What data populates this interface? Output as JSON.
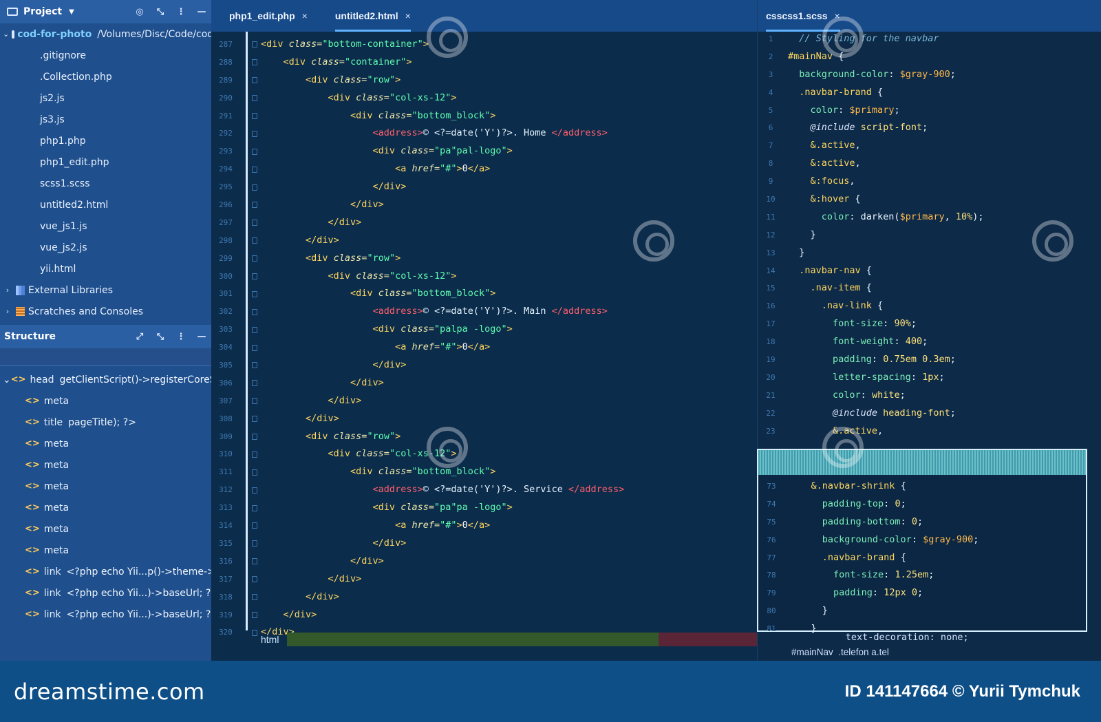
{
  "project_panel": {
    "title": "Project",
    "root_name": "cod-for-photo",
    "root_path": "/Volumes/Disc/Code/cod",
    "files": [
      ".gitignore",
      ".Collection.php",
      "js2.js",
      "js3.js",
      "php1.php",
      "php1_edit.php",
      "scss1.scss",
      "untitled2.html",
      "vue_js1.js",
      "vue_js2.js",
      "yii.html"
    ],
    "groups": [
      "External Libraries",
      "Scratches and Consoles"
    ]
  },
  "structure_panel": {
    "title": "Structure",
    "items": [
      {
        "tag": "head",
        "detail": "getClientScript()->registerCoreScrip",
        "level": 0
      },
      {
        "tag": "meta",
        "detail": "",
        "level": 1
      },
      {
        "tag": "title",
        "detail": "pageTitle); ?>",
        "level": 1
      },
      {
        "tag": "meta",
        "detail": "",
        "level": 1
      },
      {
        "tag": "meta",
        "detail": "",
        "level": 1
      },
      {
        "tag": "meta",
        "detail": "",
        "level": 1
      },
      {
        "tag": "meta",
        "detail": "",
        "level": 1
      },
      {
        "tag": "meta",
        "detail": "",
        "level": 1
      },
      {
        "tag": "meta",
        "detail": "",
        "level": 1
      },
      {
        "tag": "link",
        "detail": "<?php echo Yii...p()->theme->ba",
        "level": 1
      },
      {
        "tag": "link",
        "detail": "<?php echo Yii...)->baseUrl; ?>/c",
        "level": 1
      },
      {
        "tag": "link",
        "detail": "<?php echo Yii...)->baseUrl; ?>/c",
        "level": 1
      }
    ]
  },
  "editor_tabs": [
    {
      "label": "php1_edit.php",
      "active": false
    },
    {
      "label": "untitled2.html",
      "active": true
    }
  ],
  "right_tabs": [
    {
      "label": "csscss1.scss",
      "active": true
    }
  ],
  "editor": {
    "line_numbers": [
      "287",
      "288",
      "289",
      "290",
      "291",
      "292",
      "293",
      "294",
      "295",
      "296",
      "297",
      "298",
      "299",
      "300",
      "301",
      "302",
      "303",
      "304",
      "305",
      "306",
      "307",
      "308",
      "309",
      "310",
      "311",
      "312",
      "313",
      "314",
      "315",
      "316",
      "317",
      "318",
      "319",
      "320"
    ],
    "lines": [
      [
        {
          "t": "<div ",
          "c": "tag"
        },
        {
          "t": "class=",
          "c": "attr"
        },
        {
          "t": "\"bottom-container\"",
          "c": "str"
        },
        {
          "t": ">",
          "c": "tag"
        }
      ],
      [
        {
          "t": "    <div ",
          "c": "tag"
        },
        {
          "t": "class=",
          "c": "attr"
        },
        {
          "t": "\"container\"",
          "c": "str"
        },
        {
          "t": ">",
          "c": "tag"
        }
      ],
      [
        {
          "t": "        <div ",
          "c": "tag"
        },
        {
          "t": "class=",
          "c": "attr"
        },
        {
          "t": "\"row\"",
          "c": "str"
        },
        {
          "t": ">",
          "c": "tag"
        }
      ],
      [
        {
          "t": "            <div ",
          "c": "tag"
        },
        {
          "t": "class=",
          "c": "attr"
        },
        {
          "t": "\"col-xs-12\"",
          "c": "str"
        },
        {
          "t": ">",
          "c": "tag"
        }
      ],
      [
        {
          "t": "                <div ",
          "c": "tag"
        },
        {
          "t": "class=",
          "c": "attr"
        },
        {
          "t": "\"bottom_block\"",
          "c": "str"
        },
        {
          "t": ">",
          "c": "tag"
        }
      ],
      [
        {
          "t": "                    <address>",
          "c": "red"
        },
        {
          "t": "© <?=date('Y')?>. Home ",
          "c": "php"
        },
        {
          "t": "</address>",
          "c": "red"
        }
      ],
      [
        {
          "t": "                    <div ",
          "c": "tag"
        },
        {
          "t": "class=",
          "c": "attr"
        },
        {
          "t": "\"pa\"pal-logo\"",
          "c": "str"
        },
        {
          "t": ">",
          "c": "tag"
        }
      ],
      [
        {
          "t": "                        <a ",
          "c": "tag"
        },
        {
          "t": "href=",
          "c": "attr"
        },
        {
          "t": "\"#\"",
          "c": "str"
        },
        {
          "t": ">",
          "c": "tag"
        },
        {
          "t": "0",
          "c": "txt"
        },
        {
          "t": "</a>",
          "c": "tag"
        }
      ],
      [
        {
          "t": "                    </div>",
          "c": "tag"
        }
      ],
      [
        {
          "t": "                </div>",
          "c": "tag"
        }
      ],
      [
        {
          "t": "            </div>",
          "c": "tag"
        }
      ],
      [
        {
          "t": "        </div>",
          "c": "tag"
        }
      ],
      [
        {
          "t": "        <div ",
          "c": "tag"
        },
        {
          "t": "class=",
          "c": "attr"
        },
        {
          "t": "\"row\"",
          "c": "str"
        },
        {
          "t": ">",
          "c": "tag"
        }
      ],
      [
        {
          "t": "            <div ",
          "c": "tag"
        },
        {
          "t": "class=",
          "c": "attr"
        },
        {
          "t": "\"col-xs-12\"",
          "c": "str"
        },
        {
          "t": ">",
          "c": "tag"
        }
      ],
      [
        {
          "t": "                <div ",
          "c": "tag"
        },
        {
          "t": "class=",
          "c": "attr"
        },
        {
          "t": "\"bottom_block\"",
          "c": "str"
        },
        {
          "t": ">",
          "c": "tag"
        }
      ],
      [
        {
          "t": "                    <address>",
          "c": "red"
        },
        {
          "t": "© <?=date('Y')?>. Main ",
          "c": "php"
        },
        {
          "t": "</address>",
          "c": "red"
        }
      ],
      [
        {
          "t": "                    <div ",
          "c": "tag"
        },
        {
          "t": "class=",
          "c": "attr"
        },
        {
          "t": "\"palpa -logo\"",
          "c": "str"
        },
        {
          "t": ">",
          "c": "tag"
        }
      ],
      [
        {
          "t": "                        <a ",
          "c": "tag"
        },
        {
          "t": "href=",
          "c": "attr"
        },
        {
          "t": "\"#\"",
          "c": "str"
        },
        {
          "t": ">",
          "c": "tag"
        },
        {
          "t": "0",
          "c": "txt"
        },
        {
          "t": "</a>",
          "c": "tag"
        }
      ],
      [
        {
          "t": "                    </div>",
          "c": "tag"
        }
      ],
      [
        {
          "t": "                </div>",
          "c": "tag"
        }
      ],
      [
        {
          "t": "            </div>",
          "c": "tag"
        }
      ],
      [
        {
          "t": "        </div>",
          "c": "tag"
        }
      ],
      [
        {
          "t": "        <div ",
          "c": "tag"
        },
        {
          "t": "class=",
          "c": "attr"
        },
        {
          "t": "\"row\"",
          "c": "str"
        },
        {
          "t": ">",
          "c": "tag"
        }
      ],
      [
        {
          "t": "            <div ",
          "c": "tag"
        },
        {
          "t": "class=",
          "c": "attr"
        },
        {
          "t": "\"col-xs-12\"",
          "c": "str"
        },
        {
          "t": ">",
          "c": "tag"
        }
      ],
      [
        {
          "t": "                <div ",
          "c": "tag"
        },
        {
          "t": "class=",
          "c": "attr"
        },
        {
          "t": "\"bottom_block\"",
          "c": "str"
        },
        {
          "t": ">",
          "c": "tag"
        }
      ],
      [
        {
          "t": "                    <address>",
          "c": "red"
        },
        {
          "t": "© <?=date('Y')?>. Service ",
          "c": "php"
        },
        {
          "t": "</address>",
          "c": "red"
        }
      ],
      [
        {
          "t": "                    <div ",
          "c": "tag"
        },
        {
          "t": "class=",
          "c": "attr"
        },
        {
          "t": "\"pa\"pa -logo\"",
          "c": "str"
        },
        {
          "t": ">",
          "c": "tag"
        }
      ],
      [
        {
          "t": "                        <a ",
          "c": "tag"
        },
        {
          "t": "href=",
          "c": "attr"
        },
        {
          "t": "\"#\"",
          "c": "str"
        },
        {
          "t": ">",
          "c": "tag"
        },
        {
          "t": "0",
          "c": "txt"
        },
        {
          "t": "</a>",
          "c": "tag"
        }
      ],
      [
        {
          "t": "                    </div>",
          "c": "tag"
        }
      ],
      [
        {
          "t": "                </div>",
          "c": "tag"
        }
      ],
      [
        {
          "t": "            </div>",
          "c": "tag"
        }
      ],
      [
        {
          "t": "        </div>",
          "c": "tag"
        }
      ],
      [
        {
          "t": "    </div>",
          "c": "tag"
        }
      ],
      [
        {
          "t": "</div>",
          "c": "tag"
        }
      ]
    ],
    "breadcrumb": "html"
  },
  "scss": {
    "line_numbers": [
      "1",
      "2",
      "3",
      "4",
      "5",
      "6",
      "7",
      "8",
      "9",
      "10",
      "11",
      "12",
      "13",
      "14",
      "15",
      "16",
      "17",
      "18",
      "19",
      "20",
      "21",
      "22",
      "23"
    ],
    "lines": [
      [
        {
          "t": "  // Styling for the navbar",
          "c": "cmt"
        }
      ],
      [
        {
          "t": "#mainNav ",
          "c": "sel"
        },
        {
          "t": "{",
          "c": "pun"
        }
      ],
      [
        {
          "t": "  background-color",
          "c": "prop"
        },
        {
          "t": ": ",
          "c": "pun"
        },
        {
          "t": "$gray-900",
          "c": "var"
        },
        {
          "t": ";",
          "c": "pun"
        }
      ],
      [
        {
          "t": "  .navbar-brand ",
          "c": "sel"
        },
        {
          "t": "{",
          "c": "pun"
        }
      ],
      [
        {
          "t": "    color",
          "c": "prop"
        },
        {
          "t": ": ",
          "c": "pun"
        },
        {
          "t": "$primary",
          "c": "var"
        },
        {
          "t": ";",
          "c": "pun"
        }
      ],
      [
        {
          "t": "    @include ",
          "c": "at"
        },
        {
          "t": "script-font",
          "c": "val"
        },
        {
          "t": ";",
          "c": "pun"
        }
      ],
      [
        {
          "t": "    &.active",
          "c": "sel"
        },
        {
          "t": ",",
          "c": "pun"
        }
      ],
      [
        {
          "t": "    &:active",
          "c": "sel"
        },
        {
          "t": ",",
          "c": "pun"
        }
      ],
      [
        {
          "t": "    &:focus",
          "c": "sel"
        },
        {
          "t": ",",
          "c": "pun"
        }
      ],
      [
        {
          "t": "    &:hover ",
          "c": "sel"
        },
        {
          "t": "{",
          "c": "pun"
        }
      ],
      [
        {
          "t": "      color",
          "c": "prop"
        },
        {
          "t": ": darken(",
          "c": "pun"
        },
        {
          "t": "$primary",
          "c": "var"
        },
        {
          "t": ", ",
          "c": "pun"
        },
        {
          "t": "10%",
          "c": "val"
        },
        {
          "t": ");",
          "c": "pun"
        }
      ],
      [
        {
          "t": "    }",
          "c": "pun"
        }
      ],
      [
        {
          "t": "  }",
          "c": "pun"
        }
      ],
      [
        {
          "t": "  .navbar-nav ",
          "c": "sel"
        },
        {
          "t": "{",
          "c": "pun"
        }
      ],
      [
        {
          "t": "    .nav-item ",
          "c": "sel"
        },
        {
          "t": "{",
          "c": "pun"
        }
      ],
      [
        {
          "t": "      .nav-link ",
          "c": "sel"
        },
        {
          "t": "{",
          "c": "pun"
        }
      ],
      [
        {
          "t": "        font-size",
          "c": "prop"
        },
        {
          "t": ": ",
          "c": "pun"
        },
        {
          "t": "90%",
          "c": "val"
        },
        {
          "t": ";",
          "c": "pun"
        }
      ],
      [
        {
          "t": "        font-weight",
          "c": "prop"
        },
        {
          "t": ": ",
          "c": "pun"
        },
        {
          "t": "400",
          "c": "val"
        },
        {
          "t": ";",
          "c": "pun"
        }
      ],
      [
        {
          "t": "        padding",
          "c": "prop"
        },
        {
          "t": ": ",
          "c": "pun"
        },
        {
          "t": "0.75em 0.3em",
          "c": "val"
        },
        {
          "t": ";",
          "c": "pun"
        }
      ],
      [
        {
          "t": "        letter-spacing",
          "c": "prop"
        },
        {
          "t": ": ",
          "c": "pun"
        },
        {
          "t": "1px",
          "c": "val"
        },
        {
          "t": ";",
          "c": "pun"
        }
      ],
      [
        {
          "t": "        color",
          "c": "prop"
        },
        {
          "t": ": ",
          "c": "pun"
        },
        {
          "t": "white",
          "c": "val"
        },
        {
          "t": ";",
          "c": "pun"
        }
      ],
      [
        {
          "t": "        @include ",
          "c": "at"
        },
        {
          "t": "heading-font",
          "c": "val"
        },
        {
          "t": ";",
          "c": "pun"
        }
      ],
      [
        {
          "t": "        &.active",
          "c": "sel"
        },
        {
          "t": ",",
          "c": "pun"
        }
      ]
    ],
    "popup_line_numbers": [
      "73",
      "74",
      "75",
      "76",
      "77",
      "78",
      "79",
      "80",
      "81"
    ],
    "popup_lines": [
      [
        {
          "t": "    &.navbar-shrink ",
          "c": "sel"
        },
        {
          "t": "{",
          "c": "pun"
        }
      ],
      [
        {
          "t": "      padding-top",
          "c": "prop"
        },
        {
          "t": ": ",
          "c": "pun"
        },
        {
          "t": "0",
          "c": "val"
        },
        {
          "t": ";",
          "c": "pun"
        }
      ],
      [
        {
          "t": "      padding-bottom",
          "c": "prop"
        },
        {
          "t": ": ",
          "c": "pun"
        },
        {
          "t": "0",
          "c": "val"
        },
        {
          "t": ";",
          "c": "pun"
        }
      ],
      [
        {
          "t": "      background-color",
          "c": "prop"
        },
        {
          "t": ": ",
          "c": "pun"
        },
        {
          "t": "$gray-900",
          "c": "var"
        },
        {
          "t": ";",
          "c": "pun"
        }
      ],
      [
        {
          "t": "      .navbar-brand ",
          "c": "sel"
        },
        {
          "t": "{",
          "c": "pun"
        }
      ],
      [
        {
          "t": "        font-size",
          "c": "prop"
        },
        {
          "t": ": ",
          "c": "pun"
        },
        {
          "t": "1.25em",
          "c": "val"
        },
        {
          "t": ";",
          "c": "pun"
        }
      ],
      [
        {
          "t": "        padding",
          "c": "prop"
        },
        {
          "t": ": ",
          "c": "pun"
        },
        {
          "t": "12px 0",
          "c": "val"
        },
        {
          "t": ";",
          "c": "pun"
        }
      ],
      [
        {
          "t": "      }",
          "c": "pun"
        }
      ],
      [
        {
          "t": "    }",
          "c": "pun"
        }
      ]
    ],
    "tail_lines": [
      "      text-decoration: none;",
      "#mainNav  .telefon a.tel"
    ]
  },
  "footer": {
    "logo": "dreamstime.com",
    "credit": "ID 141147664 © Yurii Tymchuk"
  },
  "colors": {
    "sidebar": "#1f4f8c",
    "editor_bg": "#0c2c4c",
    "tag": "#ffd75f",
    "string": "#5fffb0",
    "error_tag": "#ff5f6a"
  }
}
